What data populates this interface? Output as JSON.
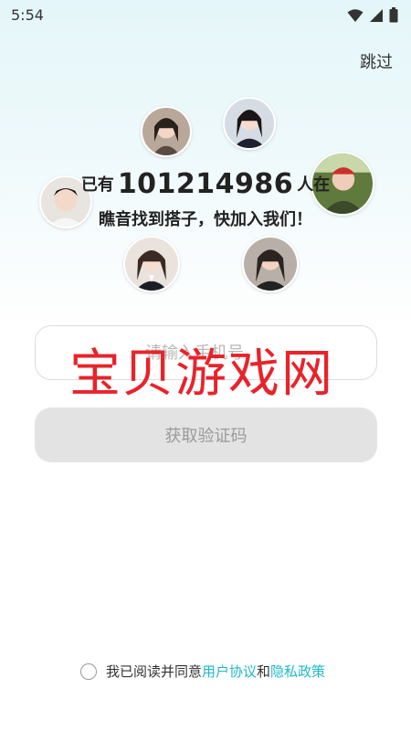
{
  "status_bar": {
    "time": "5:54"
  },
  "header": {
    "skip_label": "跳过"
  },
  "headline": {
    "prefix": "已有",
    "count": "101214986",
    "suffix": "人在",
    "line2": "瞧音找到搭子，快加入我们！"
  },
  "login": {
    "phone_placeholder": "请输入手机号",
    "code_button_label": "获取验证码"
  },
  "watermark": "宝贝游戏网",
  "agreement": {
    "text": "我已阅读并同意",
    "user_agreement": "用户协议",
    "and": "和",
    "privacy_policy": "隐私政策"
  },
  "colors": {
    "accent": "#1fb8c9",
    "watermark": "#e8232b",
    "button_disabled": "#e3e3e3"
  },
  "icons": [
    "wifi-icon",
    "signal-icon",
    "battery-icon"
  ]
}
